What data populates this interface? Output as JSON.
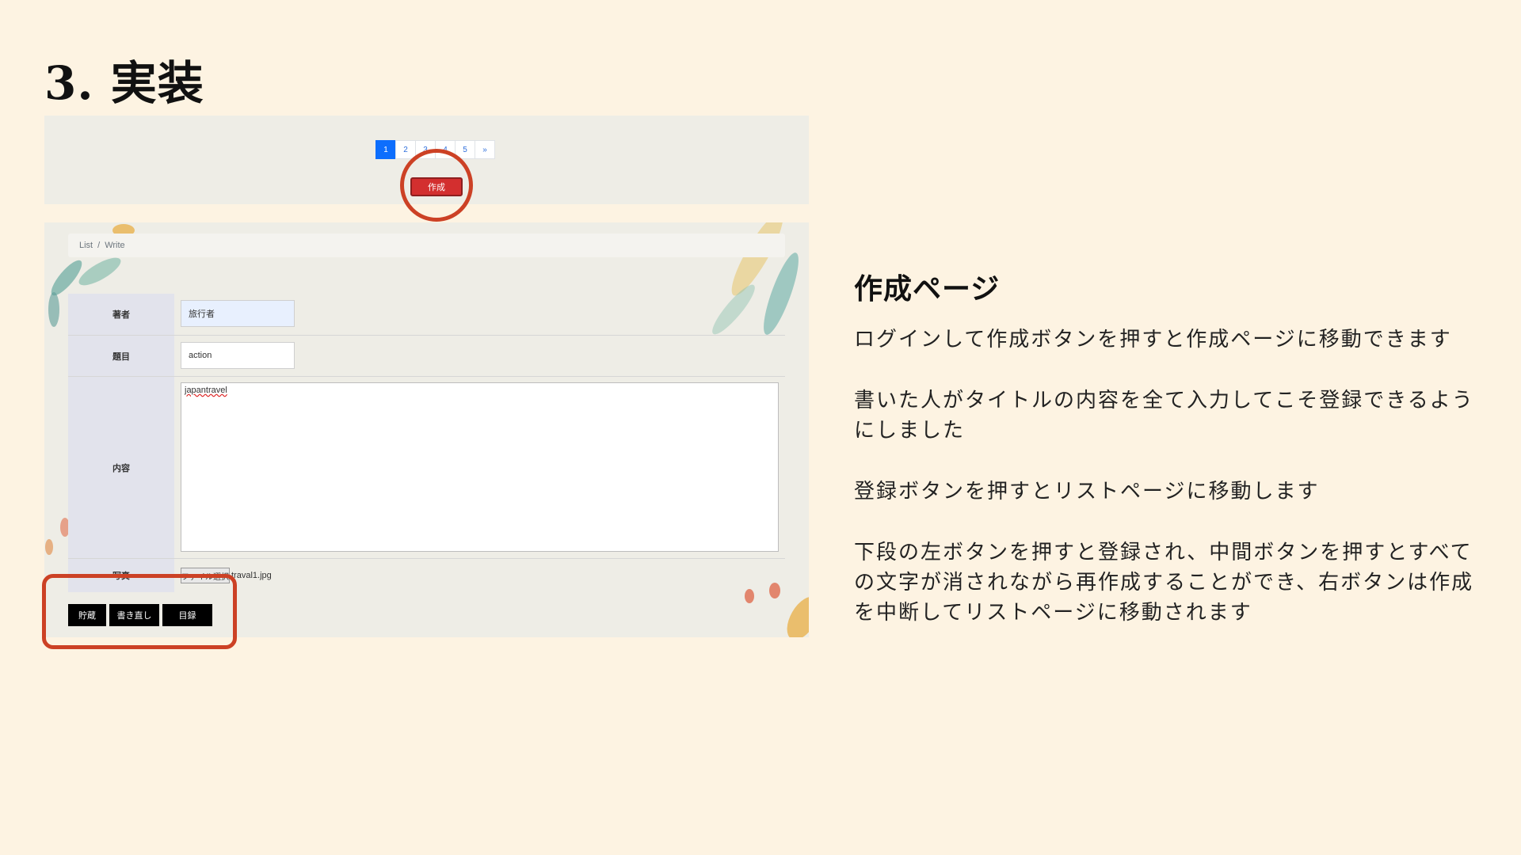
{
  "slide": {
    "title": "3. 実装"
  },
  "top_shot": {
    "pages": [
      "1",
      "2",
      "3",
      "4",
      "5",
      "»"
    ],
    "active_page": "1",
    "create_label": "作成"
  },
  "form_shot": {
    "breadcrumb": [
      "List",
      "/",
      "Write"
    ],
    "labels": {
      "author": "著者",
      "title": "題目",
      "content": "内容",
      "photo": "写真"
    },
    "values": {
      "author": "旅行者",
      "title": "action",
      "content": "japantravel",
      "file": "traval1.jpg"
    },
    "file_button": "ファイル選択",
    "buttons": [
      "貯蔵",
      "書き直し",
      "目録"
    ]
  },
  "description": {
    "heading": "作成ページ",
    "paragraphs": [
      "ログインして作成ボタンを押すと作成ページに移動できます",
      "書いた人がタイトルの内容を全て入力してこそ登録できるようにしました",
      "登録ボタンを押すとリストページに移動します",
      "下段の左ボタンを押すと登録され、中間ボタンを押すとすべての文字が消されながら再作成することができ、右ボタンは作成を中断してリストページに移動されます"
    ]
  },
  "colors": {
    "background": "#fdf3e2",
    "highlight": "#cc4125",
    "create_button": "#d32f2f",
    "active_page": "#0d6efd"
  }
}
